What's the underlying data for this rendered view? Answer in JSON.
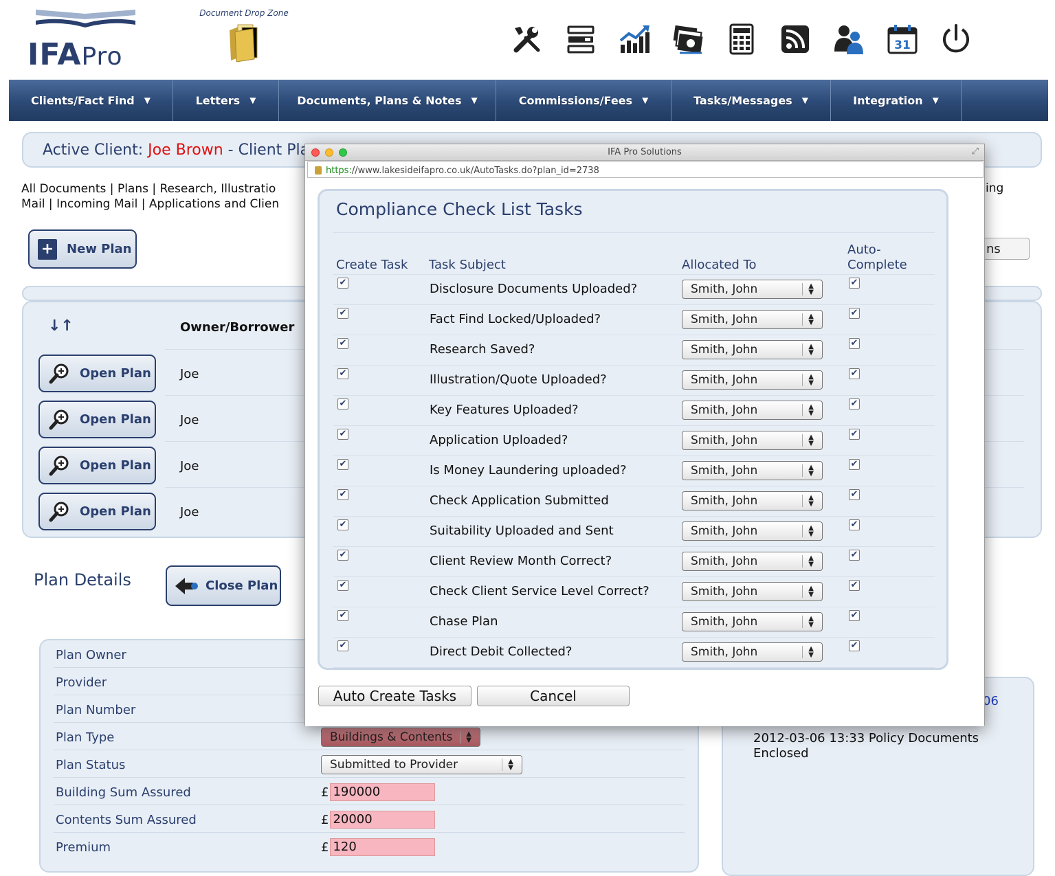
{
  "header": {
    "brand_main": "IFA",
    "brand_sub": "Pro",
    "dropzone_label": "Document Drop Zone",
    "toolbar_icons": [
      "tools-icon",
      "server-icon",
      "chart-icon",
      "money-icon",
      "calculator-icon",
      "rss-icon",
      "users-icon",
      "calendar-icon",
      "power-icon"
    ],
    "calendar_day": "31"
  },
  "menu": [
    "Clients/Fact Find",
    "Letters",
    "Documents, Plans & Notes",
    "Commissions/Fees",
    "Tasks/Messages",
    "Integration"
  ],
  "active_client": {
    "prefix": "Active Client: ",
    "name": "Joe Brown",
    "suffix": " - Client Pla"
  },
  "links": {
    "line1": "All Documents |  Plans |  Research, Illustratio",
    "line2": "Mail |  Incoming Mail |  Applications and Clien",
    "right_stub": "ing"
  },
  "buttons": {
    "new_plan": "New Plan",
    "open_plan": "Open Plan",
    "close_plan": "Close Plan",
    "right_stub": "ns"
  },
  "plans_table": {
    "owner_header": "Owner/Borrower",
    "rows": [
      "Joe",
      "Joe",
      "Joe",
      "Joe"
    ]
  },
  "plan_details": {
    "title": "Plan Details",
    "labels": [
      "Plan Owner",
      "Provider",
      "Plan Number",
      "Plan Type",
      "Plan Status",
      "Building Sum Assured",
      "Contents Sum Assured",
      "Premium"
    ],
    "plan_type": "Buildings & Contents",
    "plan_status": "Submitted to Provider",
    "currency": "£",
    "building_sum": "190000",
    "contents_sum": "20000",
    "premium": "120"
  },
  "notes": {
    "link_stub": "06",
    "line1": "2012-03-06 13:33   Policy Documents",
    "line2": "Enclosed"
  },
  "modal": {
    "window_title": "IFA Pro Solutions",
    "url_scheme": "https:",
    "url_rest": "//www.lakesideifapro.co.uk/AutoTasks.do?plan_id=2738",
    "title": "Compliance Check List Tasks",
    "col_create": "Create Task",
    "col_subject": "Task Subject",
    "col_allocated": "Allocated To",
    "col_auto_1": "Auto-",
    "col_auto_2": "Complete",
    "tasks": [
      {
        "subject": "Disclosure Documents Uploaded?",
        "allocated": "Smith, John"
      },
      {
        "subject": "Fact Find Locked/Uploaded?",
        "allocated": "Smith, John"
      },
      {
        "subject": "Research Saved?",
        "allocated": "Smith, John"
      },
      {
        "subject": "Illustration/Quote Uploaded?",
        "allocated": "Smith, John"
      },
      {
        "subject": "Key Features Uploaded?",
        "allocated": "Smith, John"
      },
      {
        "subject": "Application Uploaded?",
        "allocated": "Smith, John"
      },
      {
        "subject": "Is Money Laundering uploaded?",
        "allocated": "Smith, John"
      },
      {
        "subject": "Check Application Submitted",
        "allocated": "Smith, John"
      },
      {
        "subject": "Suitability Uploaded and Sent",
        "allocated": "Smith, John"
      },
      {
        "subject": "Client Review Month Correct?",
        "allocated": "Smith, John"
      },
      {
        "subject": "Check Client Service Level Correct?",
        "allocated": "Smith, John"
      },
      {
        "subject": "Chase Plan",
        "allocated": "Smith, John"
      },
      {
        "subject": "Direct Debit Collected?",
        "allocated": "Smith, John"
      }
    ],
    "auto_create_label": "Auto Create Tasks",
    "cancel_label": "Cancel"
  },
  "colors": {
    "brand": "#2a3f6e",
    "menu": "#2c4a76",
    "active_name": "#dd1111",
    "pink_input": "#f7b6c0"
  }
}
